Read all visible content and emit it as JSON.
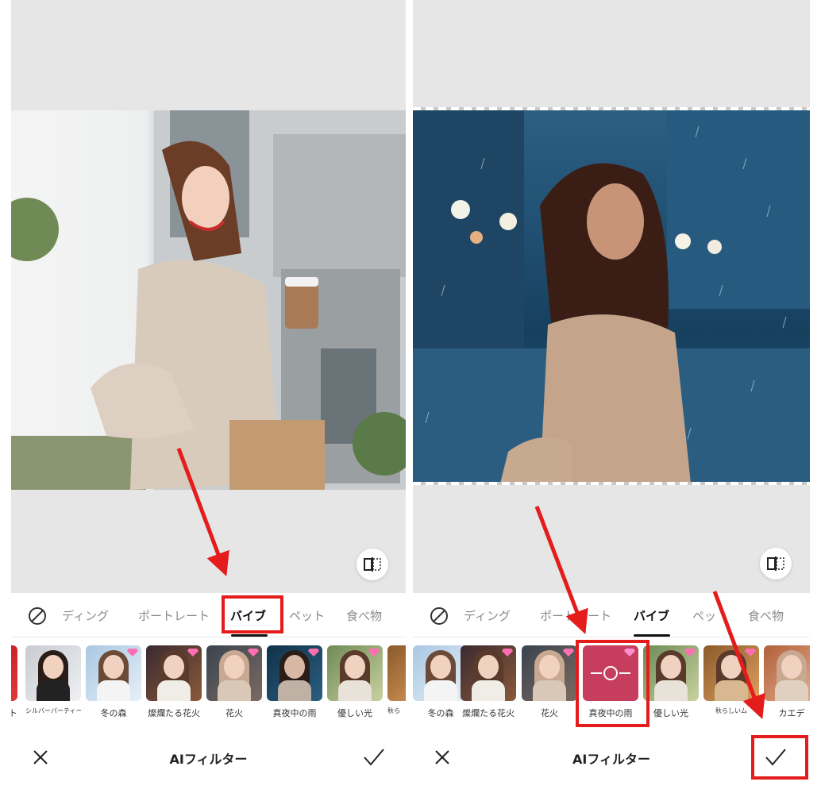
{
  "colors": {
    "accent_red": "#e51c1c",
    "tab_active": "#111111",
    "tab_inactive": "#8a8a8a",
    "canvas_bg": "#e6e6e6"
  },
  "left_panel": {
    "tabs": [
      {
        "label": "ディング"
      },
      {
        "label": "ポートレート"
      },
      {
        "label": "バイブ",
        "active": true
      },
      {
        "label": "ペット"
      },
      {
        "label": "食べ物"
      }
    ],
    "thumbs": [
      {
        "caption": "ト"
      },
      {
        "caption": "シルバーパーティー"
      },
      {
        "caption": "冬の森"
      },
      {
        "caption": "燦爛たる花火"
      },
      {
        "caption": "花火"
      },
      {
        "caption": "真夜中の雨"
      },
      {
        "caption": "優しい光"
      },
      {
        "caption": "秋ら"
      }
    ],
    "bottom_bar": {
      "title": "AIフィルター"
    },
    "icons": {
      "none": "none-icon",
      "close": "close-icon",
      "confirm": "check-icon",
      "compare": "compare-icon",
      "premium": "gem-icon"
    }
  },
  "right_panel": {
    "tabs": [
      {
        "label": "ディング"
      },
      {
        "label": "ポートレート"
      },
      {
        "label": "バイブ",
        "active": true
      },
      {
        "label": "ペッ"
      },
      {
        "label": "食べ物"
      }
    ],
    "thumbs": [
      {
        "caption": "冬の森"
      },
      {
        "caption": "燦爛たる花火"
      },
      {
        "caption": "花火"
      },
      {
        "caption": "真夜中の雨",
        "selected": true
      },
      {
        "caption": "優しい光"
      },
      {
        "caption": "秋らしいム"
      },
      {
        "caption": "カエデ"
      }
    ],
    "bottom_bar": {
      "title": "AIフィルター"
    }
  }
}
